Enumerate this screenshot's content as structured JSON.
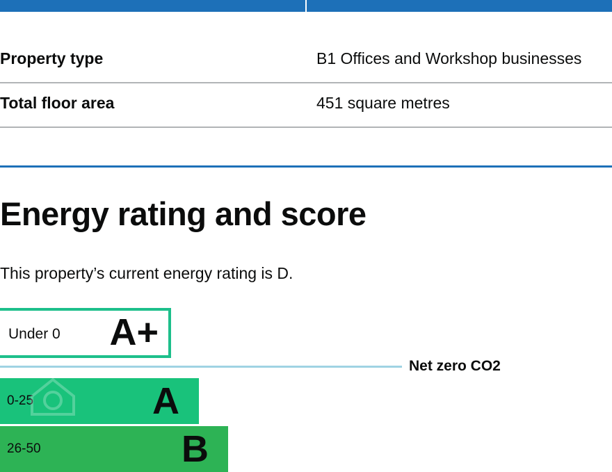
{
  "summary": {
    "rows": [
      {
        "key": "Property type",
        "value": "B1 Offices and Workshop businesses"
      },
      {
        "key": "Total floor area",
        "value": "451 square metres"
      }
    ]
  },
  "section": {
    "heading": "Energy rating and score",
    "current_rating_text": "This property’s current energy rating is D."
  },
  "rating_scale": {
    "bands": [
      {
        "range": "Under 0",
        "letter": "A+",
        "color": "#1dbf8b"
      },
      {
        "range": "0-25",
        "letter": "A",
        "color": "#19c27b"
      },
      {
        "range": "26-50",
        "letter": "B",
        "color": "#2db355"
      }
    ],
    "net_zero_label": "Net zero CO2"
  },
  "colors": {
    "header_blue": "#1d70b8",
    "divider_grey": "#b1b4b6",
    "net_zero_line": "#9fd3e3"
  }
}
